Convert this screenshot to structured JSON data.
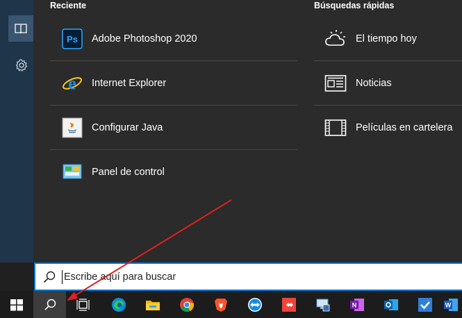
{
  "recent": {
    "title": "Reciente",
    "items": [
      {
        "label": "Adobe Photoshop 2020",
        "icon": "photoshop-icon"
      },
      {
        "label": "Internet Explorer",
        "icon": "internet-explorer-icon"
      },
      {
        "label": "Configurar Java",
        "icon": "java-icon"
      },
      {
        "label": "Panel de control",
        "icon": "control-panel-icon"
      }
    ]
  },
  "quick": {
    "title": "Búsquedas rápidas",
    "items": [
      {
        "label": "El tiempo hoy",
        "icon": "weather-icon"
      },
      {
        "label": "Noticias",
        "icon": "news-icon"
      },
      {
        "label": "Películas en cartelera",
        "icon": "film-icon"
      }
    ]
  },
  "search": {
    "placeholder": "Escribe aquí para buscar"
  },
  "rail": {
    "items": [
      {
        "icon": "book-icon"
      },
      {
        "icon": "gear-icon"
      }
    ]
  },
  "taskbar": {
    "items": [
      "windows-start-icon",
      "search-icon",
      "task-view-icon",
      "edge-icon",
      "file-explorer-icon",
      "chrome-icon",
      "brave-icon",
      "teamviewer-icon",
      "anydesk-icon",
      "remote-desktop-icon",
      "onenote-icon",
      "outlook-icon",
      "todo-icon",
      "word-icon"
    ]
  },
  "colors": {
    "accent": "#0078d4",
    "panel": "#2b2b2b",
    "rail": "#1f3549",
    "taskbar": "#1c1c1c",
    "arrow": "#e02020"
  }
}
